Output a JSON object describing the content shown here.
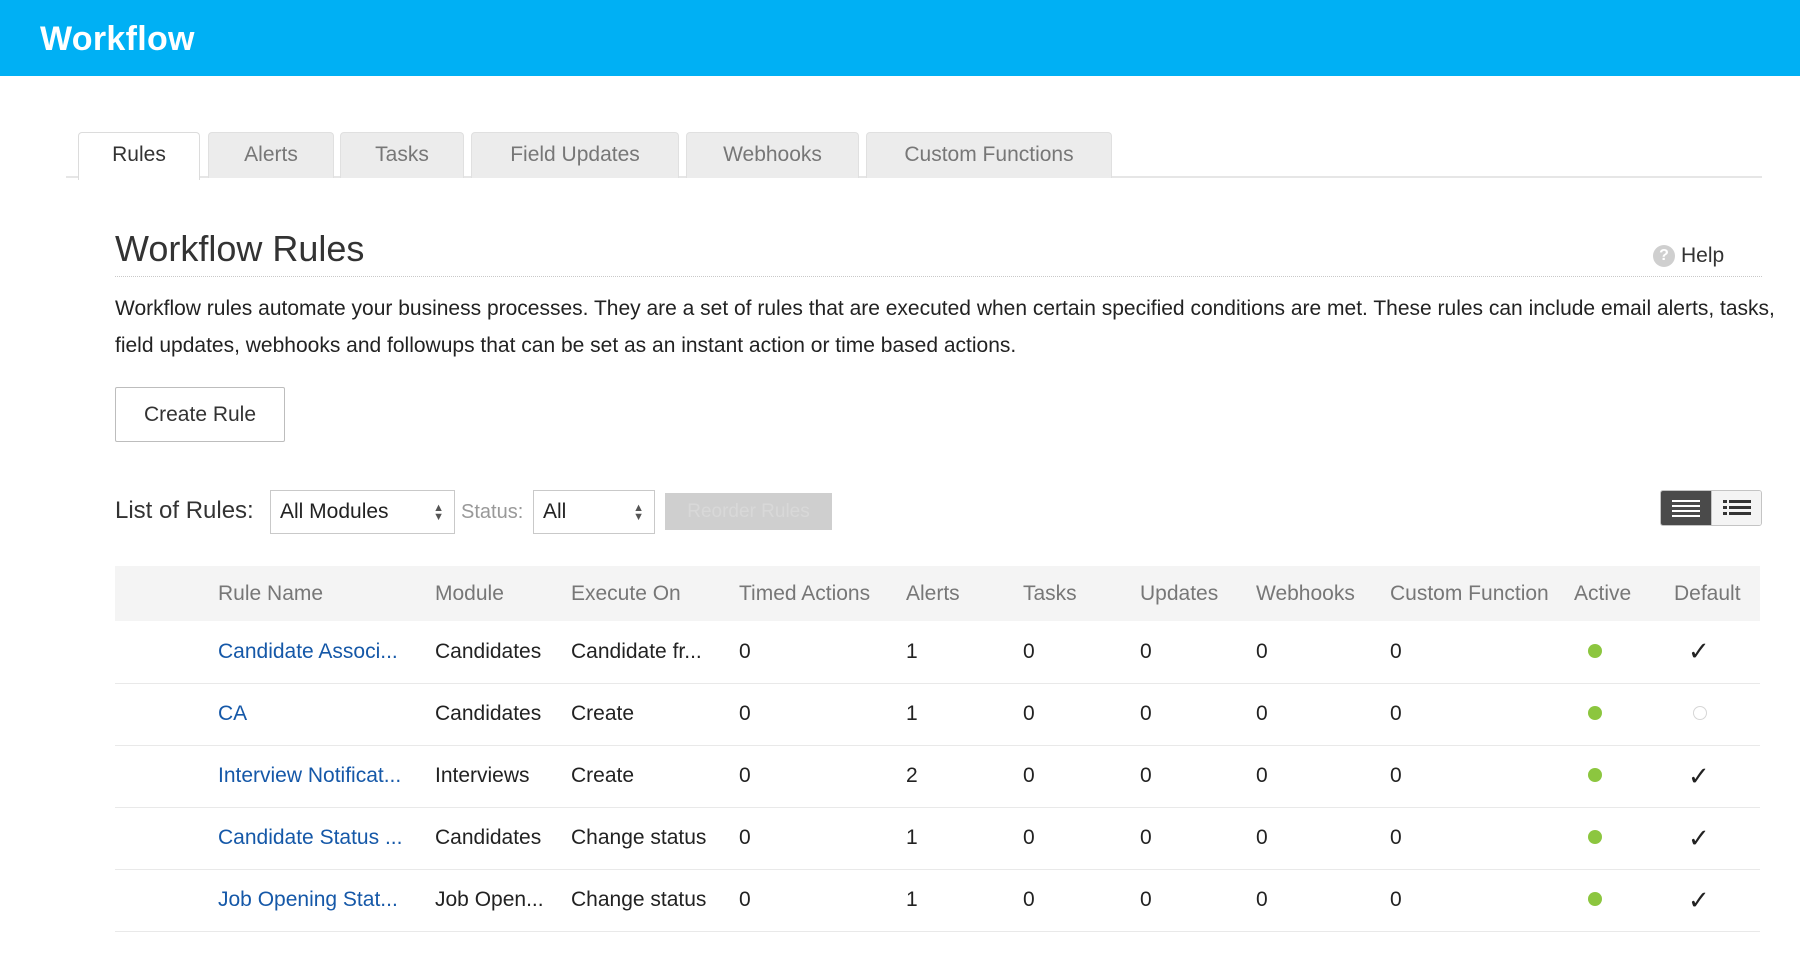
{
  "app": {
    "title": "Workflow"
  },
  "tabs": [
    {
      "label": "Rules",
      "active": true
    },
    {
      "label": "Alerts",
      "active": false
    },
    {
      "label": "Tasks",
      "active": false
    },
    {
      "label": "Field Updates",
      "active": false
    },
    {
      "label": "Webhooks",
      "active": false
    },
    {
      "label": "Custom Functions",
      "active": false
    }
  ],
  "page": {
    "title": "Workflow Rules",
    "help_label": "Help",
    "help_icon_glyph": "?",
    "description": "Workflow rules automate your business processes. They are a set of rules that are executed when certain specified conditions are met. These rules can include email alerts, tasks, field updates, webhooks and followups that can be set as an instant action or time based actions.",
    "create_button": "Create Rule"
  },
  "filters": {
    "list_label": "List of Rules:",
    "module_value": "All Modules",
    "status_label": "Status:",
    "status_value": "All",
    "reorder_label": "Reorder Rules"
  },
  "view_toggle": {
    "active": "list-view-icon",
    "inactive": "detail-view-icon"
  },
  "colors": {
    "header": "#00b0f4",
    "link": "#1558a8",
    "active_dot": "#8cc63f"
  },
  "table": {
    "columns": [
      "Rule Name",
      "Module",
      "Execute On",
      "Timed Actions",
      "Alerts",
      "Tasks",
      "Updates",
      "Webhooks",
      "Custom Function",
      "Active",
      "Default"
    ],
    "rows": [
      {
        "rule_name": "Candidate Associ...",
        "module": "Candidates",
        "execute_on": "Candidate fr...",
        "timed_actions": "0",
        "alerts": "1",
        "tasks": "0",
        "updates": "0",
        "webhooks": "0",
        "custom_function": "0",
        "active": true,
        "default": true
      },
      {
        "rule_name": "CA",
        "module": "Candidates",
        "execute_on": "Create",
        "timed_actions": "0",
        "alerts": "1",
        "tasks": "0",
        "updates": "0",
        "webhooks": "0",
        "custom_function": "0",
        "active": true,
        "default": false
      },
      {
        "rule_name": "Interview Notificat...",
        "module": "Interviews",
        "execute_on": "Create",
        "timed_actions": "0",
        "alerts": "2",
        "tasks": "0",
        "updates": "0",
        "webhooks": "0",
        "custom_function": "0",
        "active": true,
        "default": true
      },
      {
        "rule_name": "Candidate Status ...",
        "module": "Candidates",
        "execute_on": "Change status",
        "timed_actions": "0",
        "alerts": "1",
        "tasks": "0",
        "updates": "0",
        "webhooks": "0",
        "custom_function": "0",
        "active": true,
        "default": true
      },
      {
        "rule_name": "Job Opening Stat...",
        "module": "Job Open...",
        "execute_on": "Change status",
        "timed_actions": "0",
        "alerts": "1",
        "tasks": "0",
        "updates": "0",
        "webhooks": "0",
        "custom_function": "0",
        "active": true,
        "default": true
      }
    ]
  }
}
